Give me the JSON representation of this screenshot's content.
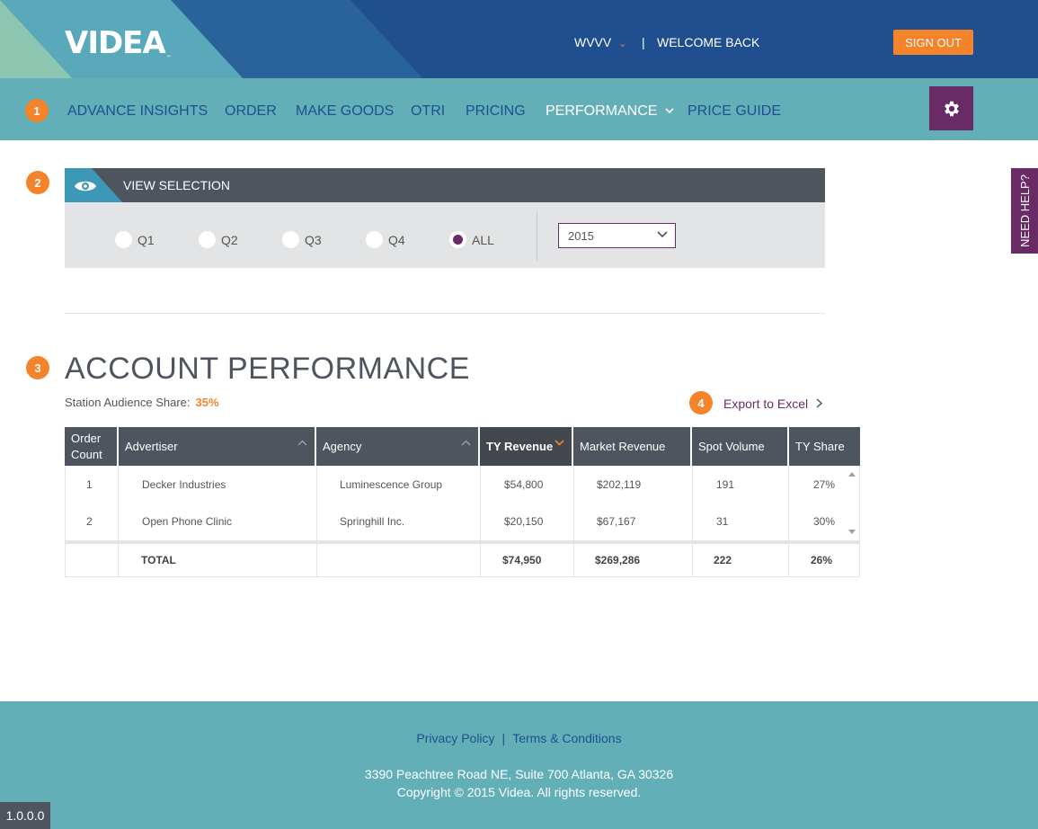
{
  "header": {
    "logo": "VIDEA",
    "logo_tm": "™",
    "station": "WVVV",
    "separator": "|",
    "welcome": "WELCOME BACK",
    "signout_label": "SIGN OUT"
  },
  "nav": {
    "badge": "1",
    "items": [
      {
        "label": "ADVANCE INSIGHTS"
      },
      {
        "label": "ORDER"
      },
      {
        "label": "MAKE GOODS"
      },
      {
        "label": "OTRI"
      },
      {
        "label": "PRICING"
      },
      {
        "label": "PERFORMANCE"
      },
      {
        "label": "PRICE GUIDE"
      }
    ],
    "active": "PERFORMANCE"
  },
  "view_selection": {
    "badge": "2",
    "title": "VIEW SELECTION",
    "options": [
      {
        "label": "Q1",
        "selected": false
      },
      {
        "label": "Q2",
        "selected": false
      },
      {
        "label": "Q3",
        "selected": false
      },
      {
        "label": "Q4",
        "selected": false
      },
      {
        "label": "ALL",
        "selected": true
      }
    ],
    "year": "2015"
  },
  "performance": {
    "badge": "3",
    "title": "ACCOUNT PERFORMANCE",
    "share_label": "Station Audience Share:",
    "share_value": "35%",
    "export_badge": "4",
    "export_label": "Export to Excel"
  },
  "table": {
    "columns": [
      {
        "label": "Order Count"
      },
      {
        "label": "Advertiser"
      },
      {
        "label": "Agency"
      },
      {
        "label": "TY Revenue"
      },
      {
        "label": "Market Revenue"
      },
      {
        "label": "Spot Volume"
      },
      {
        "label": "TY Share"
      }
    ],
    "rows": [
      [
        "1",
        "Decker Industries",
        "Luminescence Group",
        "$54,800",
        "$202,119",
        "191",
        "27%"
      ],
      [
        "2",
        "Open Phone Clinic",
        "Springhill Inc.",
        "$20,150",
        "$67,167",
        "31",
        "30%"
      ]
    ],
    "total": [
      "",
      "TOTAL",
      "",
      "$74,950",
      "$269,286",
      "222",
      "26%"
    ]
  },
  "help_label": "NEED HELP?",
  "footer": {
    "privacy": "Privacy Policy",
    "pipe": "|",
    "terms": "Terms & Conditions",
    "address": "3390 Peachtree Road NE, Suite 700 Atlanta, GA 30326",
    "copyright": "Copyright © 2015 Videa. All rights reserved."
  },
  "version": "1.0.0.0",
  "colors": {
    "navy": "#1f4f8f",
    "teal": "#62afb8",
    "orange": "#f5832a",
    "purple": "#6a2a66",
    "dark_gray": "#4f555e"
  },
  "icons": [
    "gear-icon",
    "eye-icon",
    "chevron-down-icon",
    "chevron-right-icon",
    "sort-up-icon",
    "sort-down-icon"
  ]
}
